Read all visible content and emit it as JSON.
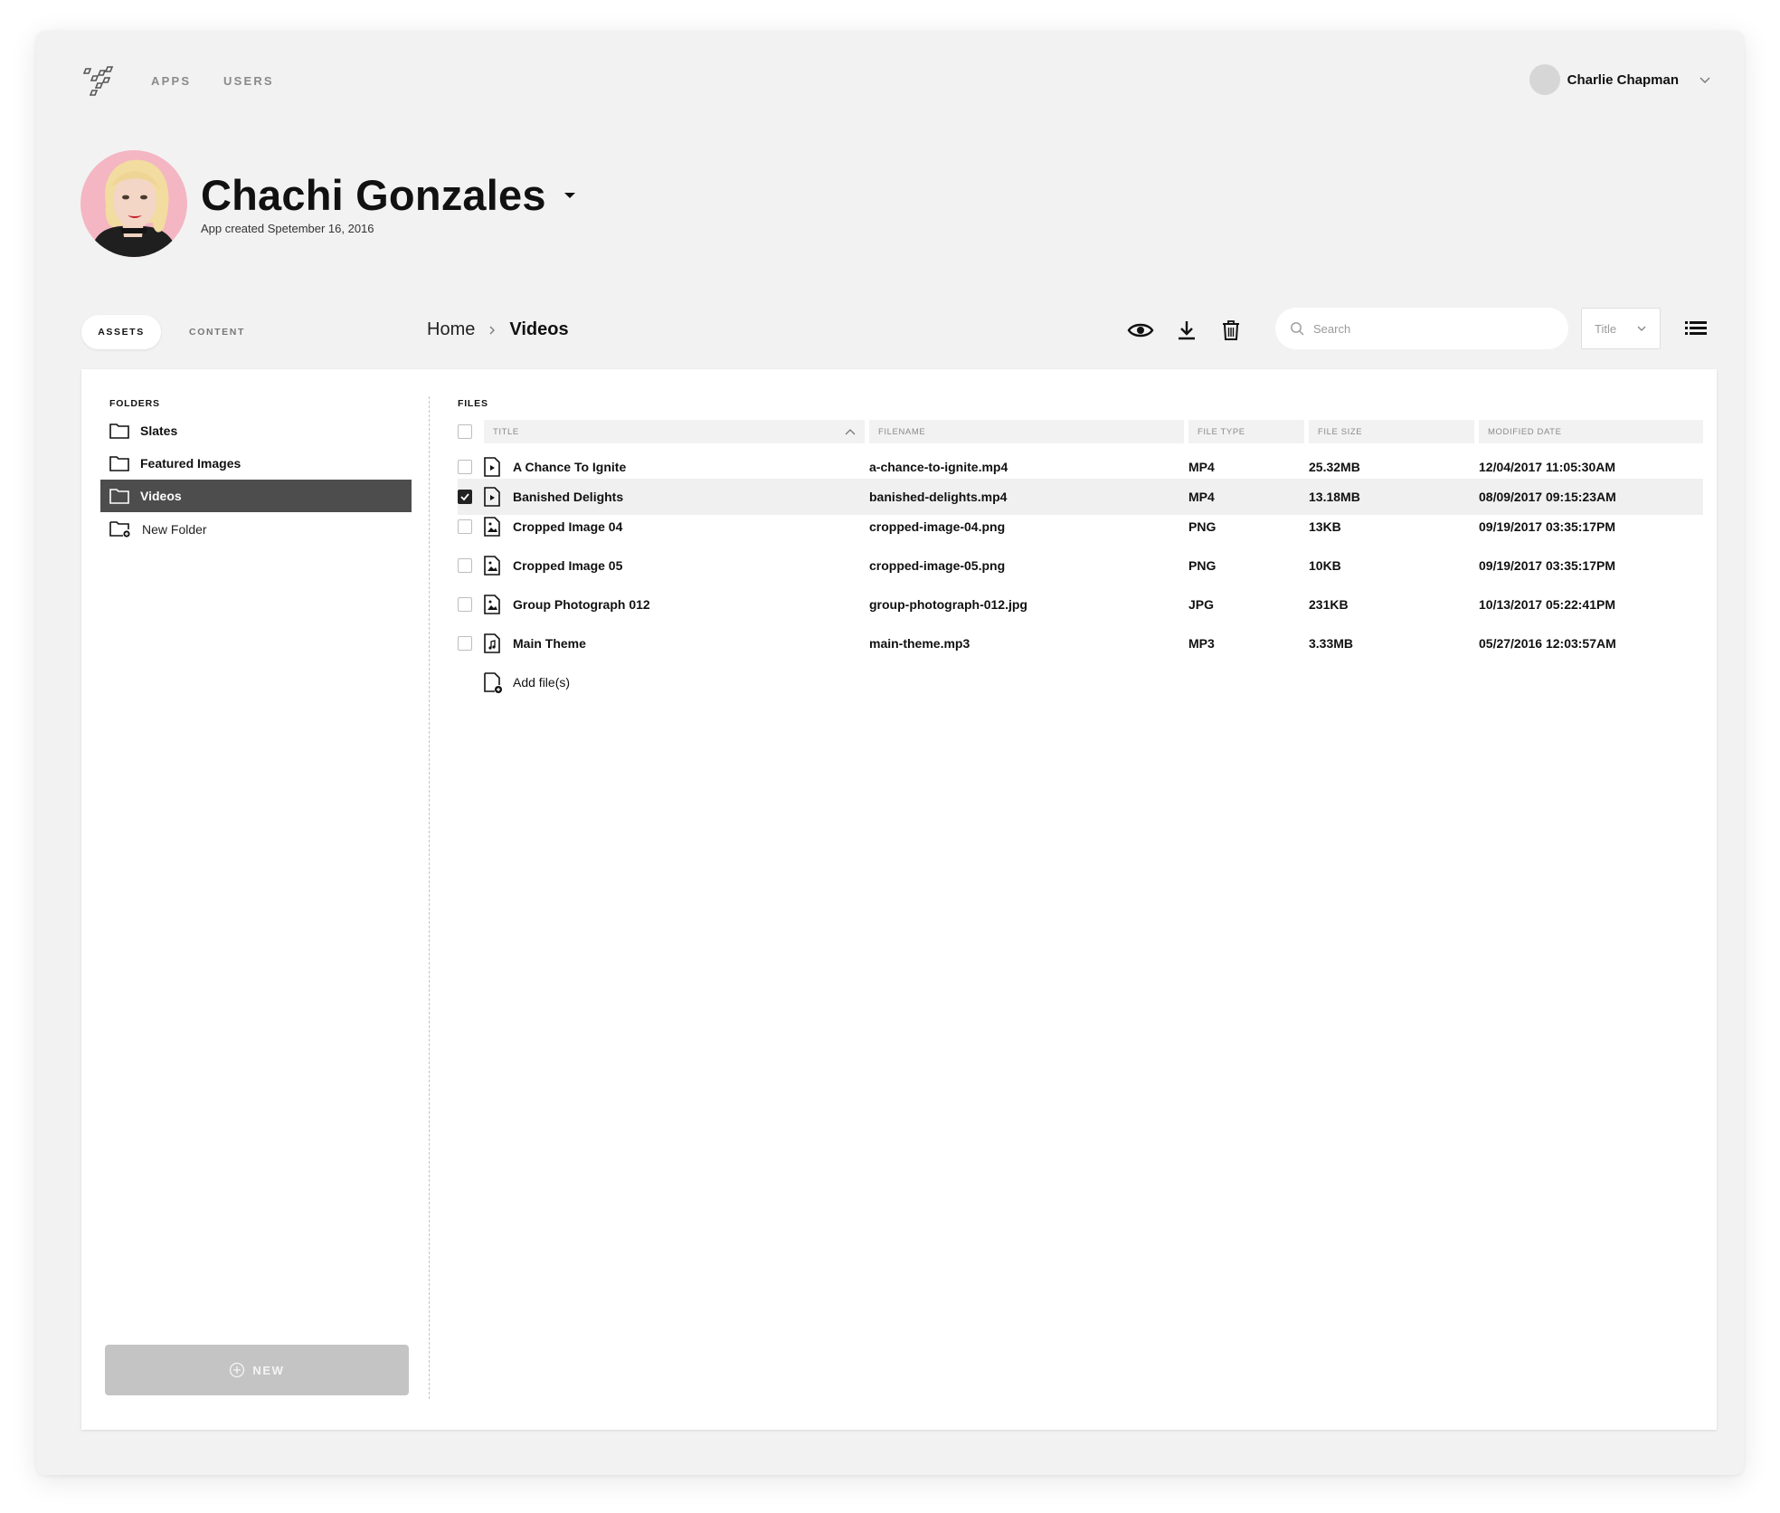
{
  "nav": {
    "links": [
      "APPS",
      "USERS"
    ],
    "user_name": "Charlie Chapman"
  },
  "app": {
    "title": "Chachi Gonzales",
    "created": "App created Spetember 16, 2016"
  },
  "tabs": [
    "ASSETS",
    "CONTENT"
  ],
  "breadcrumb": {
    "home": "Home",
    "current": "Videos"
  },
  "search": {
    "placeholder": "Search"
  },
  "sort": {
    "selected": "Title"
  },
  "folders": {
    "label": "FOLDERS",
    "items": [
      "Slates",
      "Featured Images",
      "Videos"
    ],
    "active": "Videos",
    "new_folder": "New Folder"
  },
  "files": {
    "label": "FILES",
    "columns": [
      "TITLE",
      "FILENAME",
      "FILE TYPE",
      "FILE SIZE",
      "MODIFIED DATE"
    ],
    "rows": [
      {
        "title": "A Chance To Ignite",
        "filename": "a-chance-to-ignite.mp4",
        "type": "MP4",
        "size": "25.32MB",
        "date": "12/04/2017 11:05:30AM",
        "icon": "video-file-icon",
        "checked": false
      },
      {
        "title": "Banished Delights",
        "filename": "banished-delights.mp4",
        "type": "MP4",
        "size": "13.18MB",
        "date": "08/09/2017 09:15:23AM",
        "icon": "video-file-icon",
        "checked": true
      },
      {
        "title": "Cropped Image 04",
        "filename": "cropped-image-04.png",
        "type": "PNG",
        "size": "13KB",
        "date": "09/19/2017 03:35:17PM",
        "icon": "image-file-icon",
        "checked": false
      },
      {
        "title": "Cropped Image 05",
        "filename": "cropped-image-05.png",
        "type": "PNG",
        "size": "10KB",
        "date": "09/19/2017 03:35:17PM",
        "icon": "image-file-icon",
        "checked": false
      },
      {
        "title": "Group Photograph 012",
        "filename": "group-photograph-012.jpg",
        "type": "JPG",
        "size": "231KB",
        "date": "10/13/2017 05:22:41PM",
        "icon": "image-file-icon",
        "checked": false
      },
      {
        "title": "Main Theme",
        "filename": "main-theme.mp3",
        "type": "MP3",
        "size": "3.33MB",
        "date": "05/27/2016 12:03:57AM",
        "icon": "audio-file-icon",
        "checked": false
      }
    ],
    "add_label": "Add file(s)"
  },
  "new_button": "NEW",
  "colors": {
    "shell_bg": "#f2f2f2",
    "active_folder": "#4d4d4d",
    "new_button": "#c4c4c4",
    "avatar_bg": "#f4b6c2"
  }
}
